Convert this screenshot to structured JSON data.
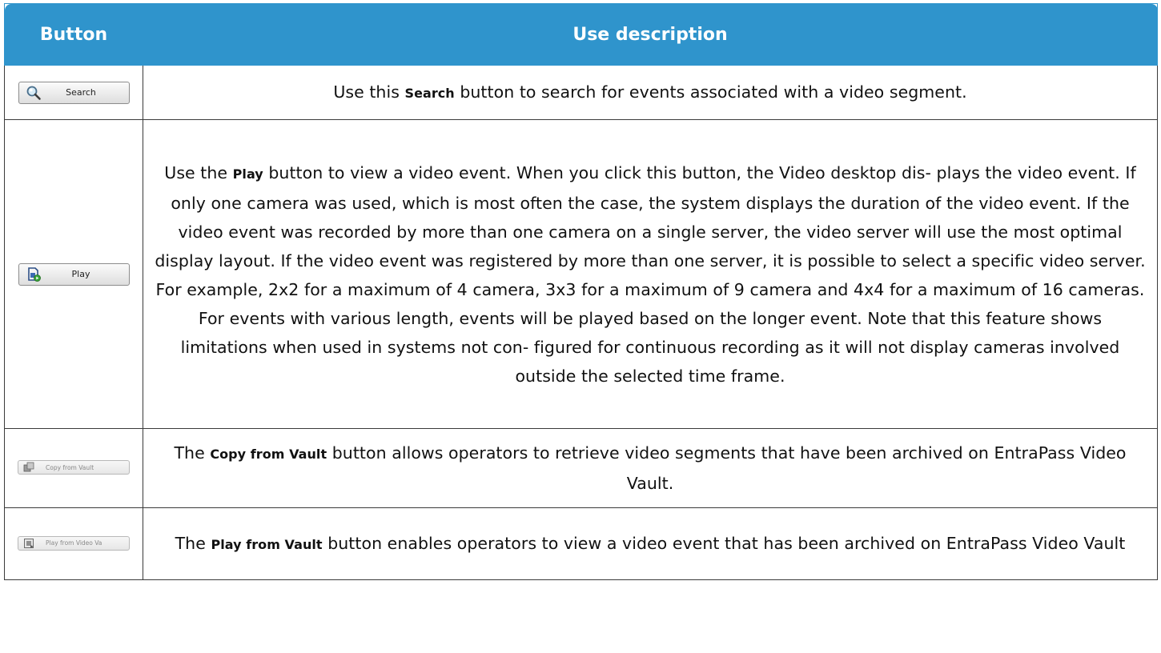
{
  "table": {
    "header": {
      "button": "Button",
      "description": "Use description"
    },
    "rows": [
      {
        "button_label": "Search",
        "button_icon": "magnifier-icon",
        "pre": "Use this ",
        "bold": "Search",
        "post": " button to search for events associated with a video segment."
      },
      {
        "button_label": "Play",
        "button_icon": "play-document-icon",
        "pre": "Use the ",
        "bold": "Play",
        "post": " button to view a video event. When you click this button, the Video desktop dis- plays the video event. If only one camera was used, which is most often the case, the system displays the duration of the video event. If the video event was recorded by more than one camera on a single server, the video server will use the most optimal display layout. If the video event was registered by more than one server, it is possible to select a specific video server. For example, 2x2 for a maximum of 4 camera, 3x3 for a maximum of 9 camera and 4x4 for a maximum of 16 cameras. For events with various length, events will be played based on the longer event. Note that this feature shows limitations when used in systems not con- figured for continuous recording as it will not display cameras involved outside the selected time frame."
      },
      {
        "button_label": "Copy from Vault",
        "button_icon": "copy-vault-icon",
        "pre": "The ",
        "bold": "Copy from Vault",
        "post": " button allows operators to retrieve video segments that have been archived on EntraPass Video Vault."
      },
      {
        "button_label": "Play from Video Va",
        "button_icon": "play-vault-icon",
        "pre": "The ",
        "bold": "Play from Vault",
        "post": " button enables operators to view a video event that has been archived on EntraPass Video Vault"
      }
    ]
  },
  "colors": {
    "header_bg": "#2f94cc",
    "header_text": "#ffffff",
    "border": "#3a3a3a"
  }
}
